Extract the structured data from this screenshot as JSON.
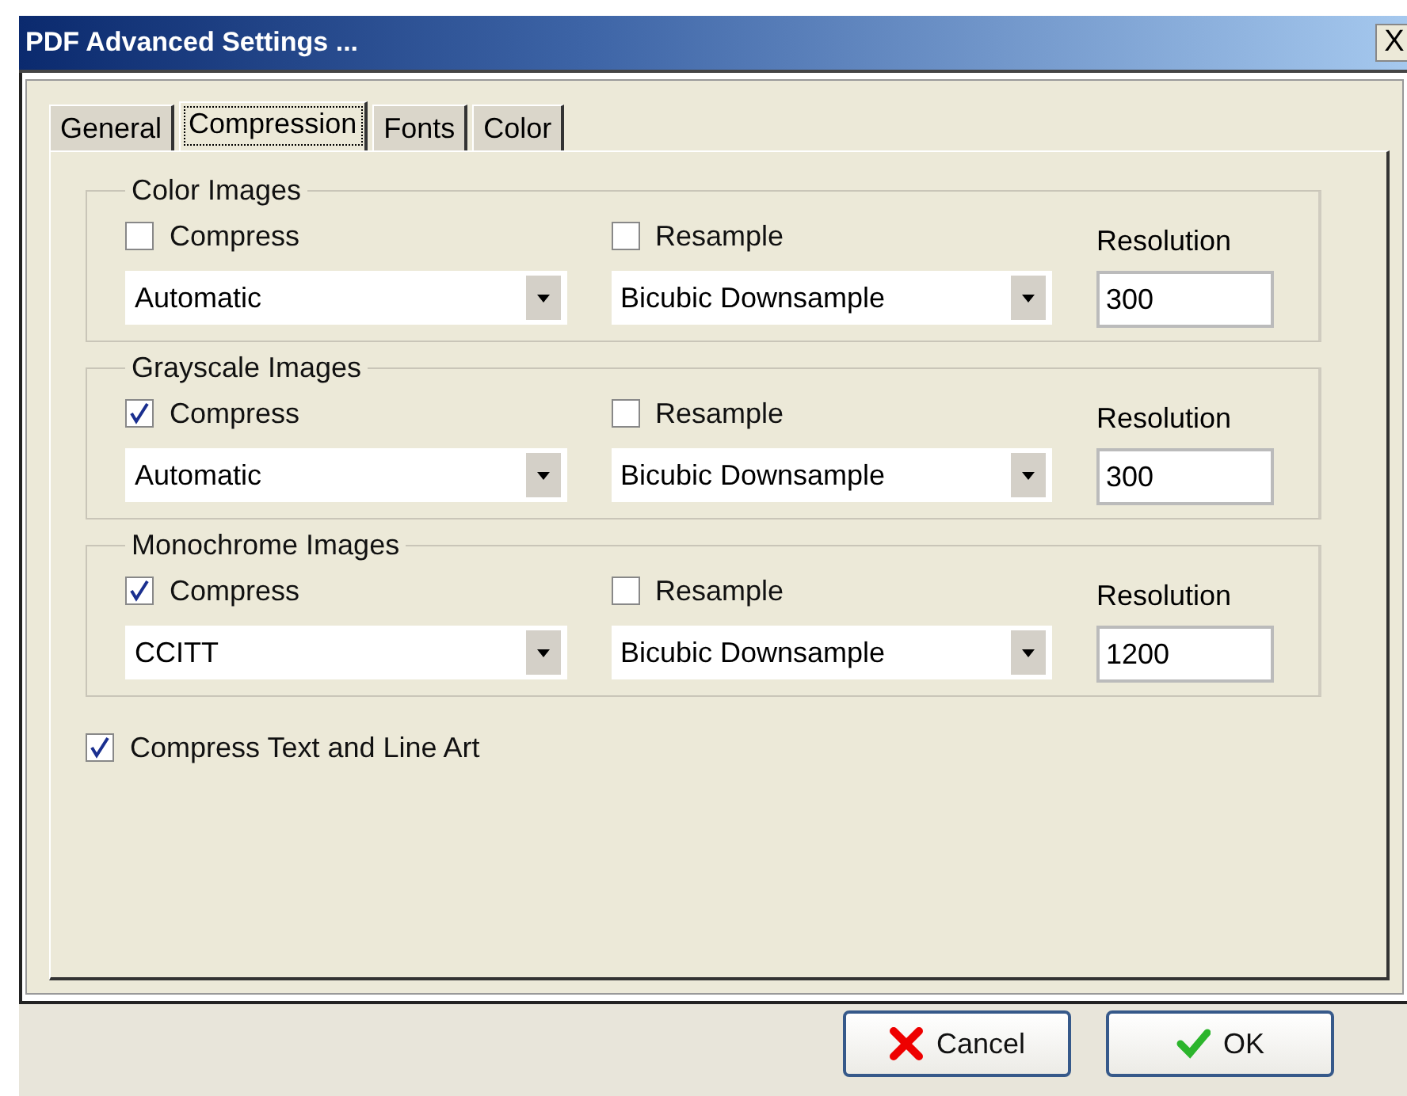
{
  "window": {
    "title": "PDF Advanced Settings ...",
    "close": "X"
  },
  "tabs": [
    {
      "label": "General",
      "selected": false
    },
    {
      "label": "Compression",
      "selected": true
    },
    {
      "label": "Fonts",
      "selected": false
    },
    {
      "label": "Color",
      "selected": false
    }
  ],
  "groups": [
    {
      "title": "Color Images",
      "compress": {
        "label": "Compress",
        "checked": false
      },
      "method": "Automatic",
      "resample": {
        "label": "Resample",
        "checked": false
      },
      "resample_method": "Bicubic Downsample",
      "resolution_label": "Resolution",
      "resolution": "300"
    },
    {
      "title": "Grayscale Images",
      "compress": {
        "label": "Compress",
        "checked": true
      },
      "method": "Automatic",
      "resample": {
        "label": "Resample",
        "checked": false
      },
      "resample_method": "Bicubic Downsample",
      "resolution_label": "Resolution",
      "resolution": "300"
    },
    {
      "title": "Monochrome Images",
      "compress": {
        "label": "Compress",
        "checked": true
      },
      "method": "CCITT",
      "resample": {
        "label": "Resample",
        "checked": false
      },
      "resample_method": "Bicubic Downsample",
      "resolution_label": "Resolution",
      "resolution": "1200"
    }
  ],
  "compress_text": {
    "label": "Compress Text and Line Art",
    "checked": true
  },
  "buttons": [
    {
      "kind": "cancel",
      "label": "Cancel"
    },
    {
      "kind": "ok",
      "label": "OK"
    }
  ]
}
